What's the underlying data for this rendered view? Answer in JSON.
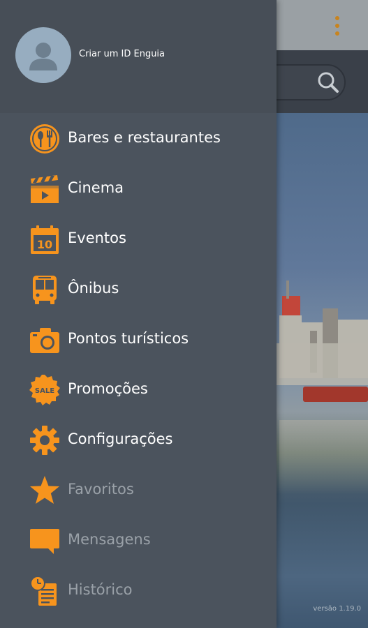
{
  "background": {
    "version_label": "versão 1.19.0",
    "search_icon": "search-icon",
    "overflow_icon": "more-vert-icon"
  },
  "drawer": {
    "header": {
      "create_account_label": "Criar um ID Enguia",
      "avatar_icon": "person-icon"
    },
    "items": [
      {
        "label": "Bares e restaurantes",
        "icon": "restaurant-icon",
        "enabled": true
      },
      {
        "label": "Cinema",
        "icon": "clapperboard-icon",
        "enabled": true
      },
      {
        "label": "Eventos",
        "icon": "calendar-icon",
        "enabled": true,
        "icon_text": "10"
      },
      {
        "label": "Ônibus",
        "icon": "bus-icon",
        "enabled": true
      },
      {
        "label": "Pontos turísticos",
        "icon": "camera-icon",
        "enabled": true
      },
      {
        "label": "Promoções",
        "icon": "sale-badge-icon",
        "enabled": true,
        "icon_text": "SALE"
      },
      {
        "label": "Configurações",
        "icon": "gear-icon",
        "enabled": true
      },
      {
        "label": "Favoritos",
        "icon": "star-icon",
        "enabled": false
      },
      {
        "label": "Mensagens",
        "icon": "message-icon",
        "enabled": false
      },
      {
        "label": "Histórico",
        "icon": "history-icon",
        "enabled": false
      }
    ]
  },
  "colors": {
    "accent": "#F7941D",
    "drawer_bg": "#4B535D",
    "header_bg": "#474E57",
    "text": "#FFFFFF",
    "text_disabled": "#9AA1A8"
  }
}
